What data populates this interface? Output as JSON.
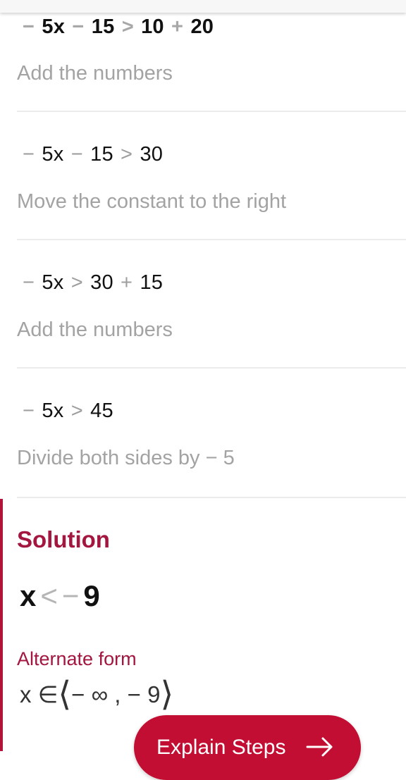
{
  "steps": [
    {
      "expression": [
        {
          "t": "−",
          "op": true
        },
        {
          "t": "5x"
        },
        {
          "t": "−",
          "op": true
        },
        {
          "t": "15"
        },
        {
          "t": ">",
          "op": true
        },
        {
          "t": "10"
        },
        {
          "t": "+",
          "op": true
        },
        {
          "t": "20"
        }
      ],
      "expression_text": "− 5x − 15 > 10 + 20",
      "description": "Add the numbers"
    },
    {
      "expression": [
        {
          "t": "−",
          "op": true
        },
        {
          "t": "5x"
        },
        {
          "t": "−",
          "op": true
        },
        {
          "t": "15"
        },
        {
          "t": ">",
          "op": true
        },
        {
          "t": "30"
        }
      ],
      "expression_text": "− 5x − 15 > 30",
      "description": "Move the constant to the right"
    },
    {
      "expression": [
        {
          "t": "−",
          "op": true
        },
        {
          "t": "5x"
        },
        {
          "t": ">",
          "op": true
        },
        {
          "t": "30"
        },
        {
          "t": "+",
          "op": true
        },
        {
          "t": "15"
        }
      ],
      "expression_text": "− 5x > 30 + 15",
      "description": "Add the numbers"
    },
    {
      "expression": [
        {
          "t": "−",
          "op": true
        },
        {
          "t": "5x"
        },
        {
          "t": ">",
          "op": true
        },
        {
          "t": "45"
        }
      ],
      "expression_text": "− 5x > 45",
      "description": "Divide both sides by − 5"
    }
  ],
  "solution": {
    "title": "Solution",
    "variable": "x",
    "relation": "<",
    "sign": "−",
    "value": "9",
    "alternate_label": "Alternate form",
    "alternate": {
      "variable": "x",
      "element_of": "∈",
      "open": "⟨",
      "lower": "− ∞",
      "separator": ",",
      "upper": "− 9",
      "close": "⟩"
    }
  },
  "explain_button": {
    "label": "Explain Steps",
    "icon": "arrow-right-icon"
  },
  "colors": {
    "accent": "#c30e33",
    "accent_text": "#a3163f",
    "muted_text": "#a3a3a3",
    "divider": "#ececec"
  }
}
